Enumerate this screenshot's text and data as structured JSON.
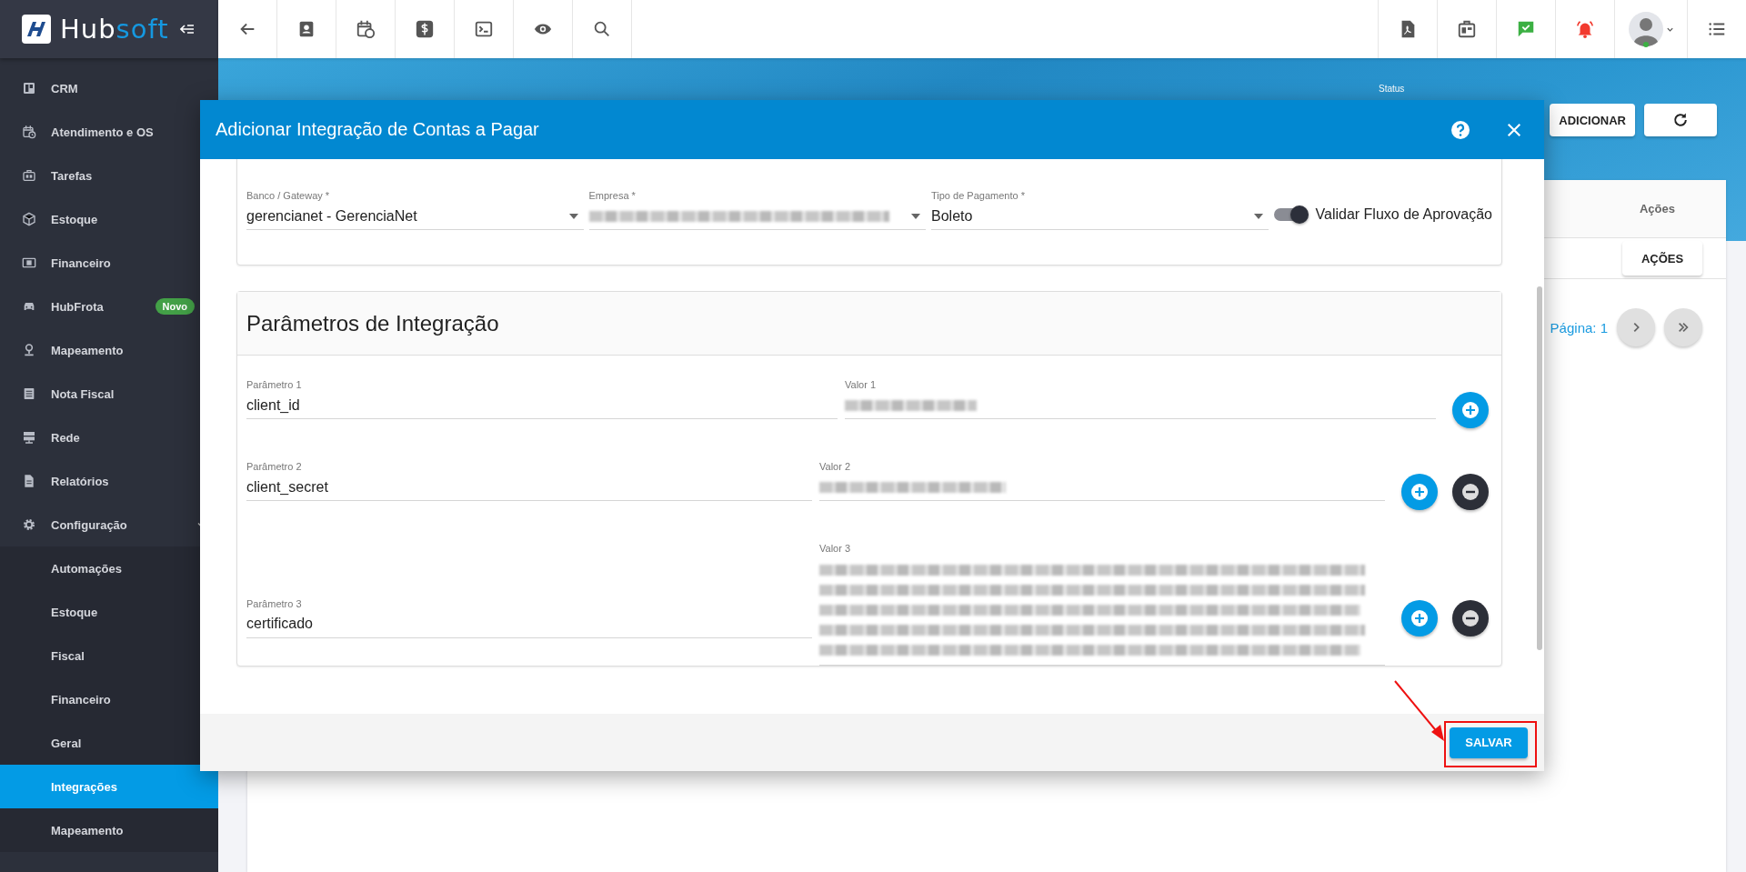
{
  "logo": {
    "text_main": "Hub",
    "text_accent": "soft"
  },
  "sidebar": {
    "items": [
      {
        "label": "CRM",
        "selected": false
      },
      {
        "label": "Atendimento e OS",
        "selected": false
      },
      {
        "label": "Tarefas",
        "selected": false
      },
      {
        "label": "Estoque",
        "selected": false
      },
      {
        "label": "Financeiro",
        "selected": false
      },
      {
        "label": "HubFrota",
        "selected": false,
        "badge": "Novo"
      },
      {
        "label": "Mapeamento",
        "selected": false
      },
      {
        "label": "Nota Fiscal",
        "selected": false
      },
      {
        "label": "Rede",
        "selected": false
      },
      {
        "label": "Relatórios",
        "selected": false
      },
      {
        "label": "Configuração",
        "selected": false,
        "expanded": true,
        "children": [
          {
            "label": "Automações",
            "selected": false
          },
          {
            "label": "Estoque",
            "selected": false
          },
          {
            "label": "Fiscal",
            "selected": false
          },
          {
            "label": "Financeiro",
            "selected": false
          },
          {
            "label": "Geral",
            "selected": false
          },
          {
            "label": "Integrações",
            "selected": true
          },
          {
            "label": "Mapeamento",
            "selected": false
          }
        ]
      }
    ]
  },
  "page": {
    "status_label": "Status",
    "add_button": "ADICIONAR",
    "table_header": "Ações",
    "actions_button": "AÇÕES",
    "page_label": "Página: 1"
  },
  "modal": {
    "title": "Adicionar Integração de Contas a Pagar",
    "fields": [
      {
        "label": "Banco / Gateway *",
        "kind": "select",
        "value": "gerencianet - GerenciaNet"
      },
      {
        "label": "Empresa *",
        "kind": "select_blurred"
      },
      {
        "label": "Tipo de Pagamento *",
        "kind": "select",
        "value": "Boleto"
      }
    ],
    "toggle": {
      "label": "Validar Fluxo de Aprovação",
      "on": true
    },
    "params_title": "Parâmetros de Integração",
    "params": [
      {
        "label": "Parâmetro 1",
        "value": "client_id",
        "value_label": "Valor 1",
        "kind": "line",
        "removable": false
      },
      {
        "label": "Parâmetro 2",
        "value": "client_secret",
        "value_label": "Valor 2",
        "kind": "line",
        "removable": true
      },
      {
        "label": "Parâmetro 3",
        "value": "certificado",
        "value_label": "Valor 3",
        "kind": "block",
        "removable": true
      }
    ],
    "save_button": "SALVAR"
  }
}
